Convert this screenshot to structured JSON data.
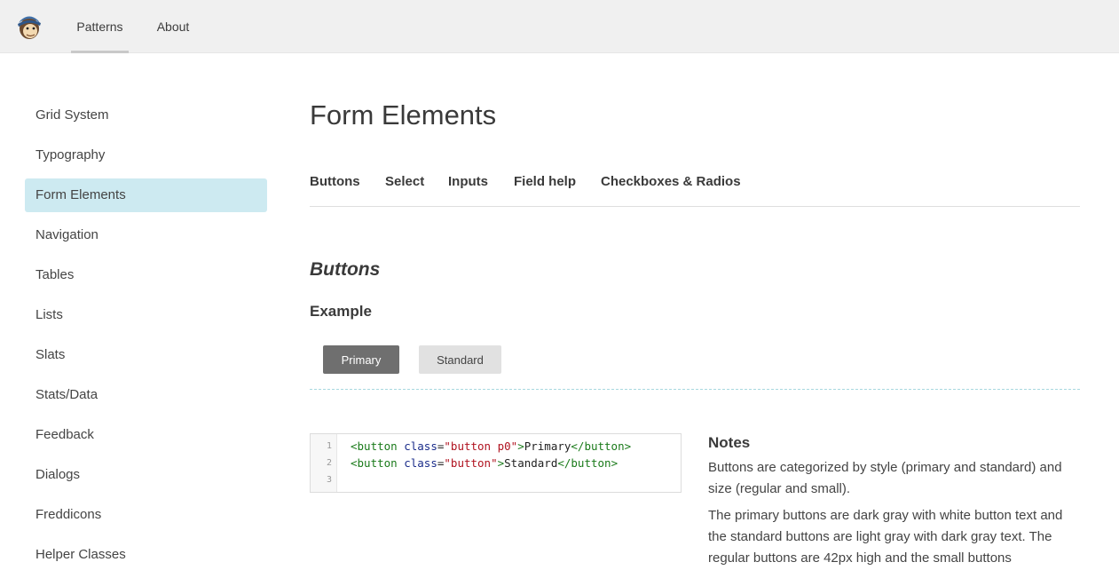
{
  "topbar": {
    "logo_alt": "Freddie",
    "nav": [
      {
        "label": "Patterns",
        "active": true
      },
      {
        "label": "About",
        "active": false
      }
    ]
  },
  "sidebar": {
    "items": [
      {
        "label": "Grid System"
      },
      {
        "label": "Typography"
      },
      {
        "label": "Form Elements",
        "active": true
      },
      {
        "label": "Navigation"
      },
      {
        "label": "Tables"
      },
      {
        "label": "Lists"
      },
      {
        "label": "Slats"
      },
      {
        "label": "Stats/Data"
      },
      {
        "label": "Feedback"
      },
      {
        "label": "Dialogs"
      },
      {
        "label": "Freddicons"
      },
      {
        "label": "Helper Classes"
      }
    ]
  },
  "main": {
    "title": "Form Elements",
    "tabs": [
      "Buttons",
      "Select",
      "Inputs",
      "Field help",
      "Checkboxes & Radios"
    ],
    "section_heading": "Buttons",
    "example_label": "Example",
    "buttons": {
      "primary": "Primary",
      "standard": "Standard"
    },
    "code": {
      "line_numbers": [
        "1",
        "2",
        "3"
      ],
      "lines": [
        {
          "open": "<button ",
          "attr": "class",
          "eq": "=",
          "value": "\"button p0\"",
          "close_open": ">",
          "text": "Primary",
          "end": "</button>"
        },
        {
          "open": "<button ",
          "attr": "class",
          "eq": "=",
          "value": "\"button\"",
          "close_open": ">",
          "text": "Standard",
          "end": "</button>"
        }
      ]
    },
    "notes": {
      "title": "Notes",
      "paragraphs": [
        "Buttons are categorized by style (primary and standard) and size (regular and small).",
        "The primary buttons are dark gray with white button text and the standard buttons are light gray with dark gray text. The regular buttons are 42px high and the small buttons"
      ]
    }
  },
  "colors": {
    "topbar_bg": "#f0f0f0",
    "sidebar_active_bg": "#cdeaf1",
    "primary_button": "#6f6f6f",
    "standard_button": "#e1e1e1",
    "dashed_divider": "#a8d8e0"
  }
}
